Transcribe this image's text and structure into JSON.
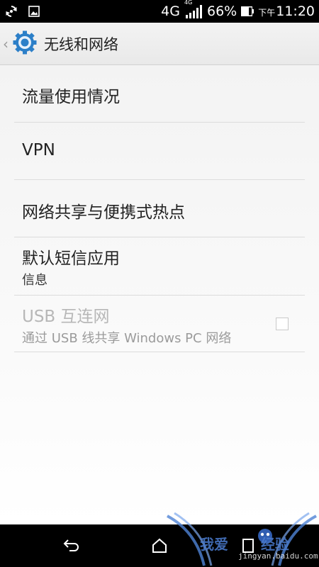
{
  "status_bar": {
    "network_type": "4G",
    "signal_sub_label": "4G",
    "battery_percent": "66%",
    "time_prefix": "下午",
    "time": "11:20",
    "left_icons": [
      "sync-icon",
      "gallery-icon"
    ],
    "right_icons": [
      "signal-bars-icon",
      "battery-icon"
    ]
  },
  "action_bar": {
    "title": "无线和网络",
    "icon": "settings-gear-icon",
    "accent_color": "#2c7fc8"
  },
  "settings": {
    "items": [
      {
        "title": "流量使用情况"
      },
      {
        "title": "VPN"
      },
      {
        "title": "网络共享与便携式热点"
      },
      {
        "title": "默认短信应用",
        "summary": "信息"
      },
      {
        "title": "USB 互连网",
        "summary": "通过 USB 线共享 Windows PC 网络",
        "enabled": false,
        "checked": false
      }
    ]
  },
  "nav_bar": {
    "buttons": [
      "back-icon",
      "home-icon",
      "recents-icon"
    ]
  },
  "watermark": {
    "text": "我爱",
    "text_suffix": "经验",
    "url": "jingyan.baidu.com"
  }
}
